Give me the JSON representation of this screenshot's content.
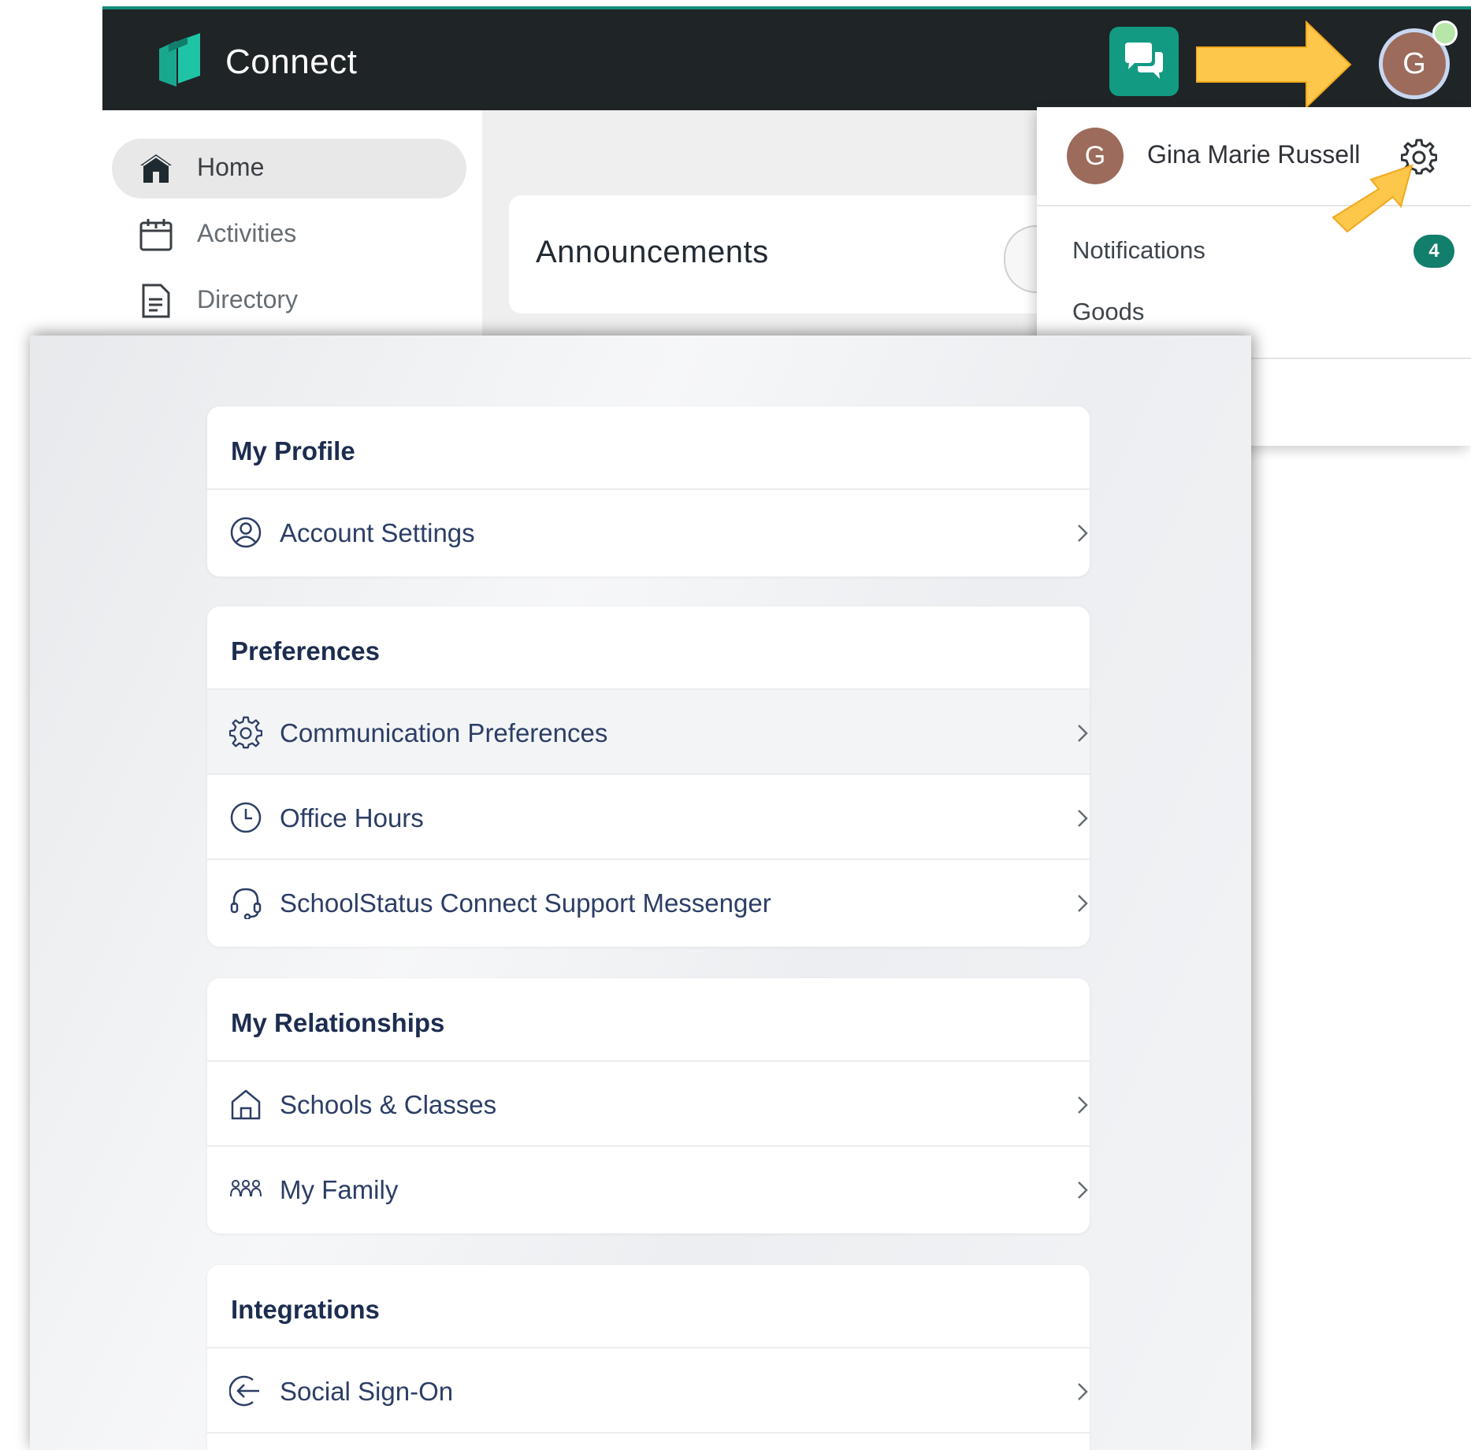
{
  "app": {
    "title": "Connect",
    "avatar_initial": "G"
  },
  "sidebar": {
    "items": [
      {
        "label": "Home",
        "icon": "home-icon",
        "active": true
      },
      {
        "label": "Activities",
        "icon": "calendar-icon",
        "active": false
      },
      {
        "label": "Directory",
        "icon": "document-icon",
        "active": false
      }
    ]
  },
  "main": {
    "announcements_title": "Announcements"
  },
  "user_menu": {
    "avatar_initial": "G",
    "name": "Gina Marie Russell",
    "items": [
      {
        "label": "Notifications",
        "badge": "4"
      },
      {
        "label": "Goods"
      }
    ]
  },
  "settings": {
    "sections": [
      {
        "title": "My Profile",
        "rows": [
          {
            "label": "Account Settings",
            "icon": "user-circle-icon"
          }
        ]
      },
      {
        "title": "Preferences",
        "rows": [
          {
            "label": "Communication Preferences",
            "icon": "gear-icon"
          },
          {
            "label": "Office Hours",
            "icon": "clock-icon"
          },
          {
            "label": "SchoolStatus Connect Support Messenger",
            "icon": "headset-icon"
          }
        ]
      },
      {
        "title": "My Relationships",
        "rows": [
          {
            "label": "Schools & Classes",
            "icon": "house-icon"
          },
          {
            "label": "My Family",
            "icon": "family-icon"
          }
        ]
      },
      {
        "title": "Integrations",
        "rows": [
          {
            "label": "Social Sign-On",
            "icon": "sign-in-icon"
          }
        ]
      }
    ]
  },
  "colors": {
    "topbar": "#1f2426",
    "accent": "#129a83",
    "badge": "#127e6c",
    "annotation_arrow": "#fcc74a",
    "heading_text": "#1d2d50"
  }
}
